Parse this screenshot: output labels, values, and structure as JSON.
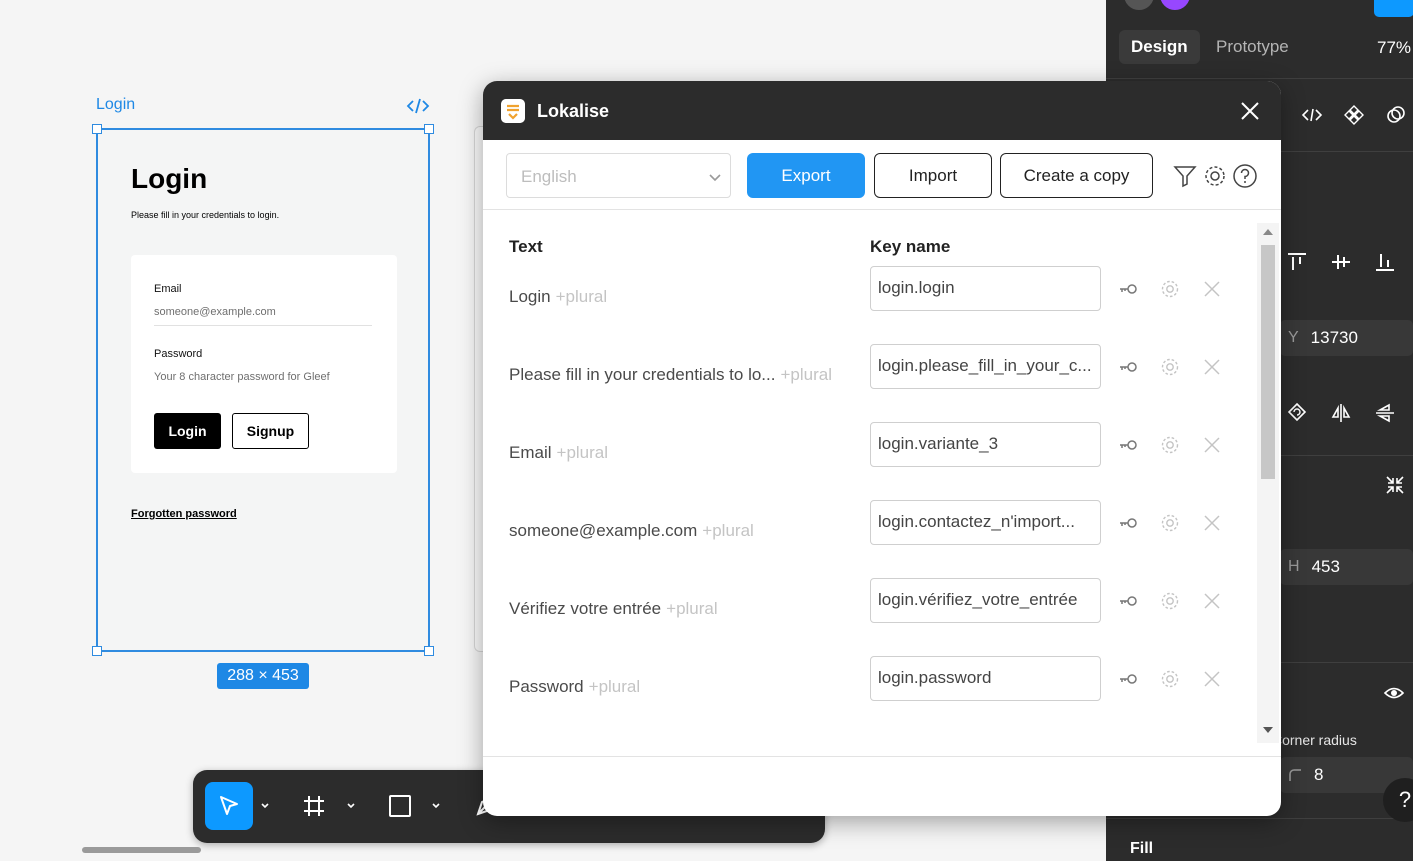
{
  "canvas": {
    "frame_name": "Login",
    "frame_size": "288 × 453",
    "frame": {
      "title": "Login",
      "subtitle": "Please fill in your credentials to login.",
      "email_label": "Email",
      "email_placeholder": "someone@example.com",
      "password_label": "Password",
      "password_placeholder": "Your 8 character password for Gleef",
      "login_button": "Login",
      "signup_button": "Signup",
      "forgot_link": "Forgotten password"
    },
    "accent_color": "#1e88e5"
  },
  "design_panel": {
    "tabs": [
      {
        "label": "Design",
        "active": true
      },
      {
        "label": "Prototype",
        "active": false
      }
    ],
    "zoom": "77%",
    "y": {
      "label": "Y",
      "value": "13730"
    },
    "h": {
      "label": "H",
      "value": "453"
    },
    "corner_radius_label": "Corner radius",
    "corner_radius_value": "8",
    "fill_label": "Fill",
    "help": "?"
  },
  "plugin": {
    "title": "Lokalise",
    "language_select": {
      "value": "English"
    },
    "buttons": {
      "export": "Export",
      "import": "Import",
      "create_copy": "Create a copy"
    },
    "columns": {
      "text": "Text",
      "key": "Key name"
    },
    "plural_tag": "+plural",
    "rows": [
      {
        "text": "Login",
        "key": "login.login"
      },
      {
        "text": "Please fill in your credentials to lo...",
        "key": "login.please_fill_in_your_c..."
      },
      {
        "text": "Email",
        "key": "login.variante_3"
      },
      {
        "text": "someone@example.com",
        "key": "login.contactez_n'import..."
      },
      {
        "text": "Vérifiez votre entrée",
        "key": "login.vérifiez_votre_entrée"
      },
      {
        "text": "Password",
        "key": "login.password"
      }
    ],
    "primary_color": "#2196f3"
  }
}
